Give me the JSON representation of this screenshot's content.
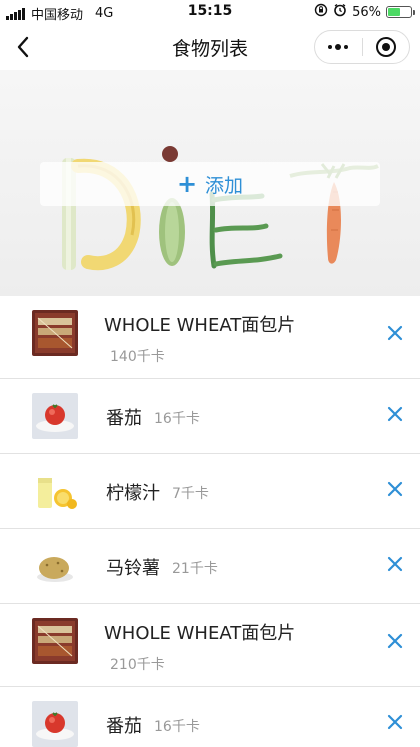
{
  "status_bar": {
    "carrier": "中国移动",
    "network": "4G",
    "time": "15:15",
    "battery": "56%",
    "battery_level": 0.56,
    "battery_color": "#4cd964"
  },
  "nav": {
    "title": "食物列表",
    "back_icon": "chevron-left-icon",
    "more_icon": "more-dots-icon",
    "close_icon": "target-circle-icon"
  },
  "banner": {
    "add_label": "添加",
    "add_icon": "plus-icon",
    "accent_color": "#2e8fd6"
  },
  "foods": [
    {
      "name": "WHOLE WHEAT面包片",
      "kcal": "140千卡",
      "image": "bread-bag-image",
      "layout": "stacked"
    },
    {
      "name": "番茄",
      "kcal": "16千卡",
      "image": "tomato-plate-image",
      "layout": "inline"
    },
    {
      "name": "柠檬汁",
      "kcal": "7千卡",
      "image": "lemon-juice-image",
      "layout": "inline"
    },
    {
      "name": "马铃薯",
      "kcal": "21千卡",
      "image": "potato-image",
      "layout": "inline"
    },
    {
      "name": "WHOLE WHEAT面包片",
      "kcal": "210千卡",
      "image": "bread-bag-image",
      "layout": "stacked"
    },
    {
      "name": "番茄",
      "kcal": "16千卡",
      "image": "tomato-plate-image",
      "layout": "inline"
    }
  ],
  "delete_icon": "close-x-icon"
}
